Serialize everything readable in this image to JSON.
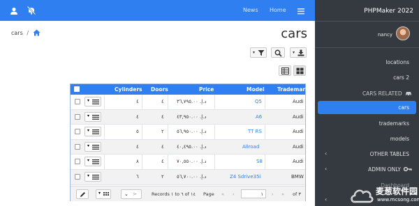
{
  "topbar": {
    "links": [
      "News",
      "Home"
    ],
    "icons": [
      "user-icon",
      "notifications-off-icon",
      "hamburger-menu-icon"
    ]
  },
  "breadcrumb": {
    "item": "cars",
    "separator": "/"
  },
  "page_title": "cars",
  "toolbar": {
    "buttons": [
      "filter-button",
      "search-button",
      "export-button"
    ],
    "view_buttons": [
      "table-view-button",
      "grid-view-button"
    ]
  },
  "grid": {
    "columns": [
      "Cylinders",
      "Doors",
      "Price",
      "Model",
      "Trademark"
    ],
    "rows": [
      {
        "cylinders": "٤",
        "doors": "٤",
        "price": "د.إ.‏ ٣٦,٧٩٥.٠٠",
        "model": "Q5",
        "trademark": "Audi"
      },
      {
        "cylinders": "٤",
        "doors": "٤",
        "price": "د.إ.‏ ٤٣,٩٥٠.٠٠",
        "model": "A6",
        "trademark": "Audi"
      },
      {
        "cylinders": "٥",
        "doors": "٢",
        "price": "د.إ.‏ ٥٦,٩٥٠.٠٠",
        "model": "TT RS",
        "trademark": "Audi"
      },
      {
        "cylinders": "٤",
        "doors": "٤",
        "price": "د.إ.‏ ٤٠,٤٩٥.٠٠",
        "model": "Allroad",
        "trademark": "Audi"
      },
      {
        "cylinders": "٨",
        "doors": "٤",
        "price": "د.إ.‏ ٧٠,٥٥٠.٠٠",
        "model": "S8",
        "trademark": "Audi"
      },
      {
        "cylinders": "٦",
        "doors": "٢",
        "price": "د.إ.‏ ٥٦,٧٠٠.٠٠",
        "model": "Z4 Sdrive35i",
        "trademark": "BMW"
      }
    ],
    "footer": {
      "records_text": "Records ١ to ٦ of ١٤",
      "page_label": "Page",
      "page_value": "١",
      "of_text": "of ٣"
    }
  },
  "sidebar": {
    "brand": "PHPMaker 2022",
    "user": "nancy",
    "items": [
      "locations",
      "cars 2",
      "CARS RELATED",
      "cars",
      "trademarks",
      "models",
      "OTHER TABLES",
      "ADMIN ONLY",
      "Dashboard"
    ]
  },
  "watermark": {
    "line1": "麦葱软件园",
    "line2": "www.mcsong.com"
  }
}
